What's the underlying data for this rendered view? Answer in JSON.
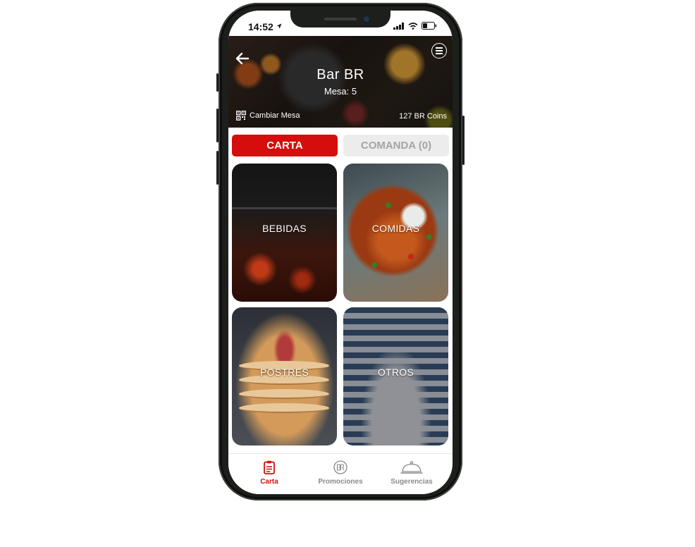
{
  "status_bar": {
    "time": "14:52"
  },
  "header": {
    "bar_name": "Bar BR",
    "mesa": "Mesa: 5",
    "cambiar_mesa": "Cambiar Mesa",
    "coins": "127 BR Coins"
  },
  "tabs": {
    "carta": "CARTA",
    "comanda": "COMANDA (0)"
  },
  "categories": [
    {
      "label": "BEBIDAS"
    },
    {
      "label": "COMIDAS"
    },
    {
      "label": "POSTRES"
    },
    {
      "label": "OTROS"
    }
  ],
  "bottom_nav": [
    {
      "label": "Carta",
      "icon": "clipboard-icon"
    },
    {
      "label": "Promociones",
      "icon": "br-logo-icon"
    },
    {
      "label": "Sugerencias",
      "icon": "cloche-icon"
    }
  ],
  "colors": {
    "accent": "#d50d0d",
    "inactive_tab": "#ececec",
    "inactive_text": "#a4a4a4"
  }
}
